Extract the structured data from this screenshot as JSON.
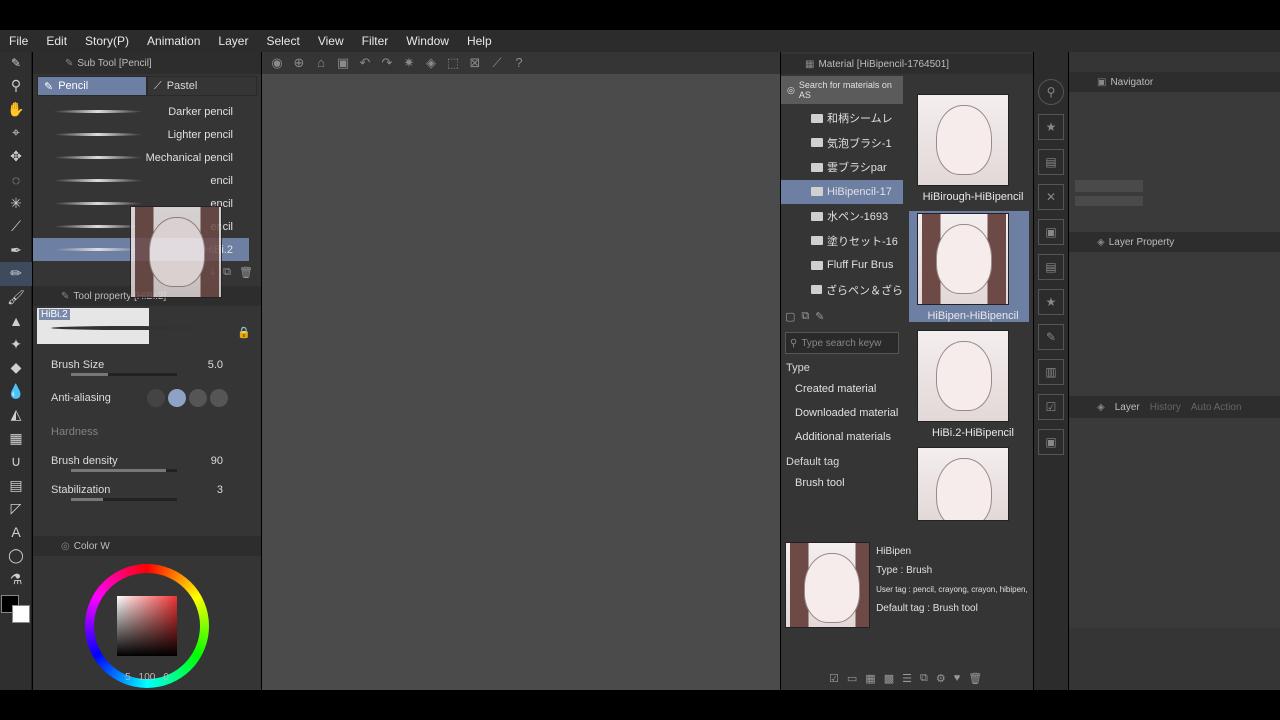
{
  "menu": [
    "File",
    "Edit",
    "Story(P)",
    "Animation",
    "Layer",
    "Select",
    "View",
    "Filter",
    "Window",
    "Help"
  ],
  "sub_tool": {
    "header": "Sub Tool [Pencil]",
    "tabs": [
      "Pencil",
      "Pastel"
    ],
    "brushes": [
      "Darker pencil",
      "Lighter pencil",
      "Mechanical pencil",
      "encil",
      "encil",
      "encil",
      "HiBi.2"
    ]
  },
  "tool_property": {
    "header": "Tool property [HiBi.2]",
    "preview_label": "HiBi.2",
    "rows": [
      {
        "label": "Brush Size",
        "value": "5.0",
        "fill": 0.35
      },
      {
        "label": "Anti-aliasing",
        "value": ""
      },
      {
        "label": "Hardness",
        "value": ""
      },
      {
        "label": "Brush density",
        "value": "90",
        "fill": 0.9
      },
      {
        "label": "Stabilization",
        "value": "3",
        "fill": 0.3
      }
    ]
  },
  "color_panel": {
    "header": "Color W",
    "status": {
      "a": "5",
      "b": "100",
      "c": "0"
    }
  },
  "material": {
    "header": "Material [HiBipencil-1764501]",
    "search_placeholder": "Search for materials on AS",
    "folders": [
      "和柄シームレ",
      "気泡ブラシ-1",
      "雲ブラシpar",
      "HiBipencil-17",
      "水ペン-1693",
      "塗りセット-16",
      "Fluff Fur Brus",
      "ざらペン＆ざら"
    ],
    "selected_folder": 3,
    "keyword_placeholder": "Type search keyw",
    "type_label": "Type",
    "type_filters": [
      "Created material",
      "Downloaded material",
      "Additional materials"
    ],
    "default_tag_label": "Default tag",
    "tag_filters": [
      "Brush tool"
    ],
    "thumbnails": [
      "HiBirough-HiBipencil",
      "HiBipen-HiBipencil",
      "HiBi.2-HiBipencil",
      ""
    ],
    "selected_thumbnail": 1,
    "detail": {
      "name": "HiBipen",
      "type": "Type : Brush",
      "user_tag": "User tag : pencil, crayong, crayon, hibipen, h",
      "default_tag": "Default tag : Brush tool"
    }
  },
  "navigator": {
    "header": "Navigator"
  },
  "layer_property": {
    "header": "Layer Property"
  },
  "layer_tabs": [
    "Layer",
    "History",
    "Auto Action"
  ]
}
